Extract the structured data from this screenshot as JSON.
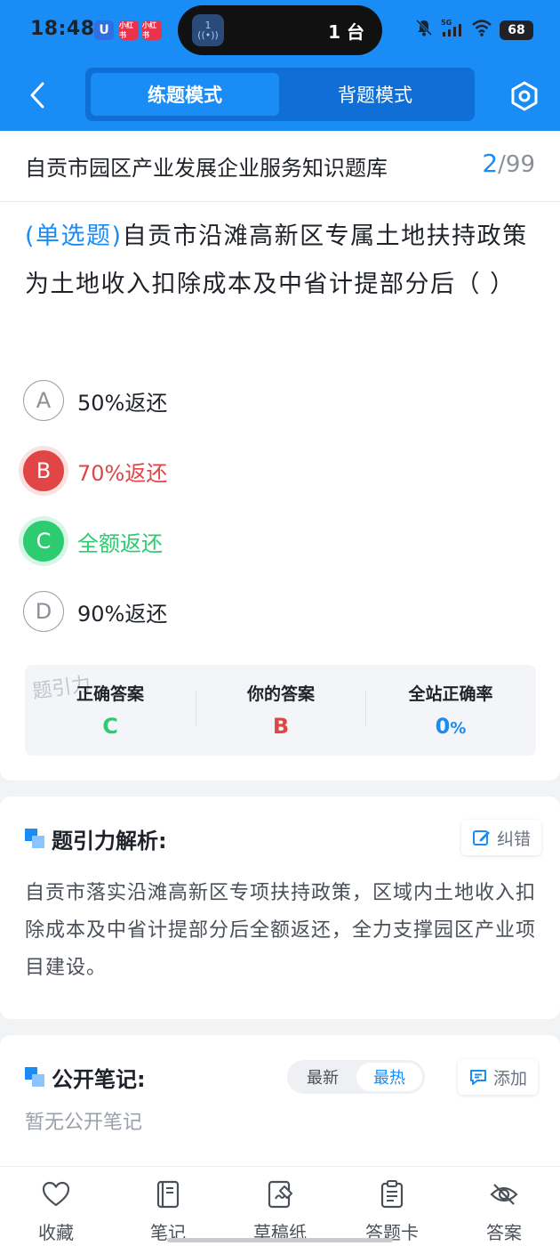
{
  "status_bar": {
    "time": "18:48",
    "app_icons": [
      "U",
      "小红书",
      "小红书"
    ],
    "island_badge": "1",
    "island_label": "1 台",
    "battery": "68",
    "network": "5G"
  },
  "header": {
    "tabs": [
      "练题模式",
      "背题模式"
    ],
    "active_tab": 0,
    "accent_color": "#1a8cf5"
  },
  "question_card": {
    "bank_title": "自贡市园区产业发展企业服务知识题库",
    "current": "2",
    "total": "/99",
    "question_type": "(单选题)",
    "question_text": "自贡市沿滩高新区专属土地扶持政策为土地收入扣除成本及中省计提部分后（    ）",
    "options": [
      {
        "letter": "A",
        "text": "50%返还",
        "state": "normal"
      },
      {
        "letter": "B",
        "text": "70%返还",
        "state": "wrong"
      },
      {
        "letter": "C",
        "text": "全额返还",
        "state": "correct"
      },
      {
        "letter": "D",
        "text": "90%返还",
        "state": "normal"
      }
    ],
    "watermark": "题引力",
    "result": {
      "correct_label": "正确答案",
      "correct_value": "C",
      "yours_label": "你的答案",
      "yours_value": "B",
      "rate_label": "全站正确率",
      "rate_value": "0",
      "rate_unit": "%"
    }
  },
  "analysis": {
    "title": "题引力解析:",
    "report_label": "纠错",
    "text": "自贡市落实沿滩高新区专项扶持政策，区域内土地收入扣除成本及中省计提部分后全额返还，全力支撑园区产业项目建设。"
  },
  "notes": {
    "title": "公开笔记:",
    "sort_options": [
      "最新",
      "最热"
    ],
    "active_sort": 1,
    "add_label": "添加",
    "empty_text": "暂无公开笔记"
  },
  "bottom_bar": {
    "items": [
      {
        "label": "收藏",
        "icon": "heart-icon"
      },
      {
        "label": "笔记",
        "icon": "notebook-icon"
      },
      {
        "label": "草稿纸",
        "icon": "draft-icon"
      },
      {
        "label": "答题卡",
        "icon": "clipboard-icon"
      },
      {
        "label": "答案",
        "icon": "eye-off-icon"
      }
    ]
  }
}
